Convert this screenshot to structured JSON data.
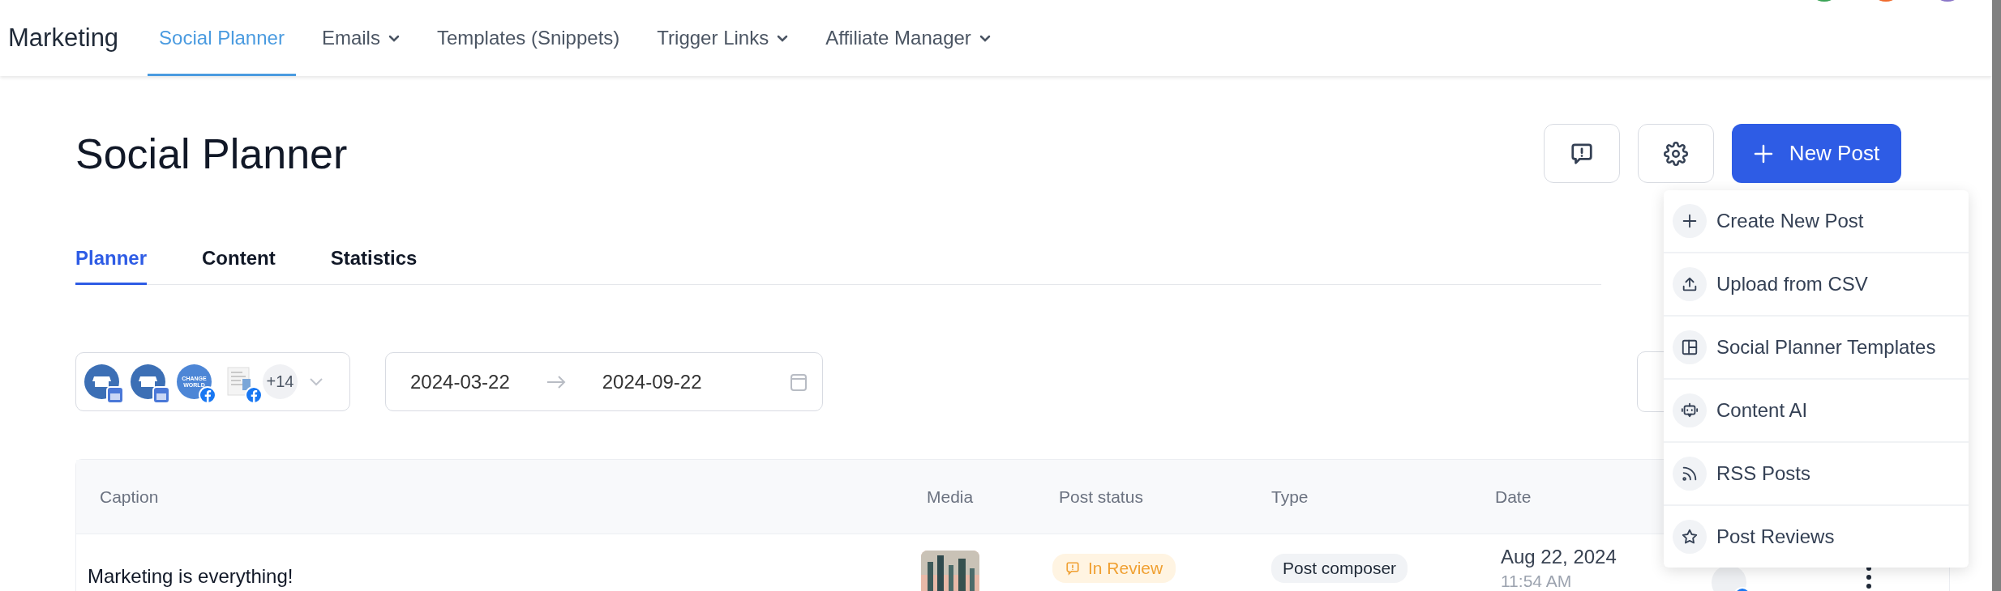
{
  "nav": {
    "brand": "Marketing",
    "items": [
      {
        "label": "Social Planner",
        "selected": true,
        "dropdown": false
      },
      {
        "label": "Emails",
        "selected": false,
        "dropdown": true
      },
      {
        "label": "Templates (Snippets)",
        "selected": false,
        "dropdown": false
      },
      {
        "label": "Trigger Links",
        "selected": false,
        "dropdown": true
      },
      {
        "label": "Affiliate Manager",
        "selected": false,
        "dropdown": true
      }
    ]
  },
  "page_title": "Social Planner",
  "new_post_button": "New Post",
  "new_post_menu": [
    "Create New Post",
    "Upload from CSV",
    "Social Planner Templates",
    "Content AI",
    "RSS Posts",
    "Post Reviews"
  ],
  "tabs": [
    {
      "label": "Planner",
      "selected": true
    },
    {
      "label": "Content",
      "selected": false
    },
    {
      "label": "Statistics",
      "selected": false
    }
  ],
  "accounts": {
    "avatars": [
      {
        "kind": "store"
      },
      {
        "kind": "store"
      },
      {
        "kind": "logo",
        "label": "CHANGE WORLD"
      },
      {
        "kind": "document"
      }
    ],
    "more": "+14"
  },
  "date_range": {
    "start": "2024-03-22",
    "end": "2024-09-22"
  },
  "table": {
    "columns": [
      "Caption",
      "Media",
      "Post status",
      "Type",
      "Date"
    ],
    "rows": [
      {
        "caption": "Marketing is everything!",
        "status": "In Review",
        "type": "Post composer",
        "date": "Aug 22, 2024",
        "time": "11:54 AM"
      }
    ]
  }
}
